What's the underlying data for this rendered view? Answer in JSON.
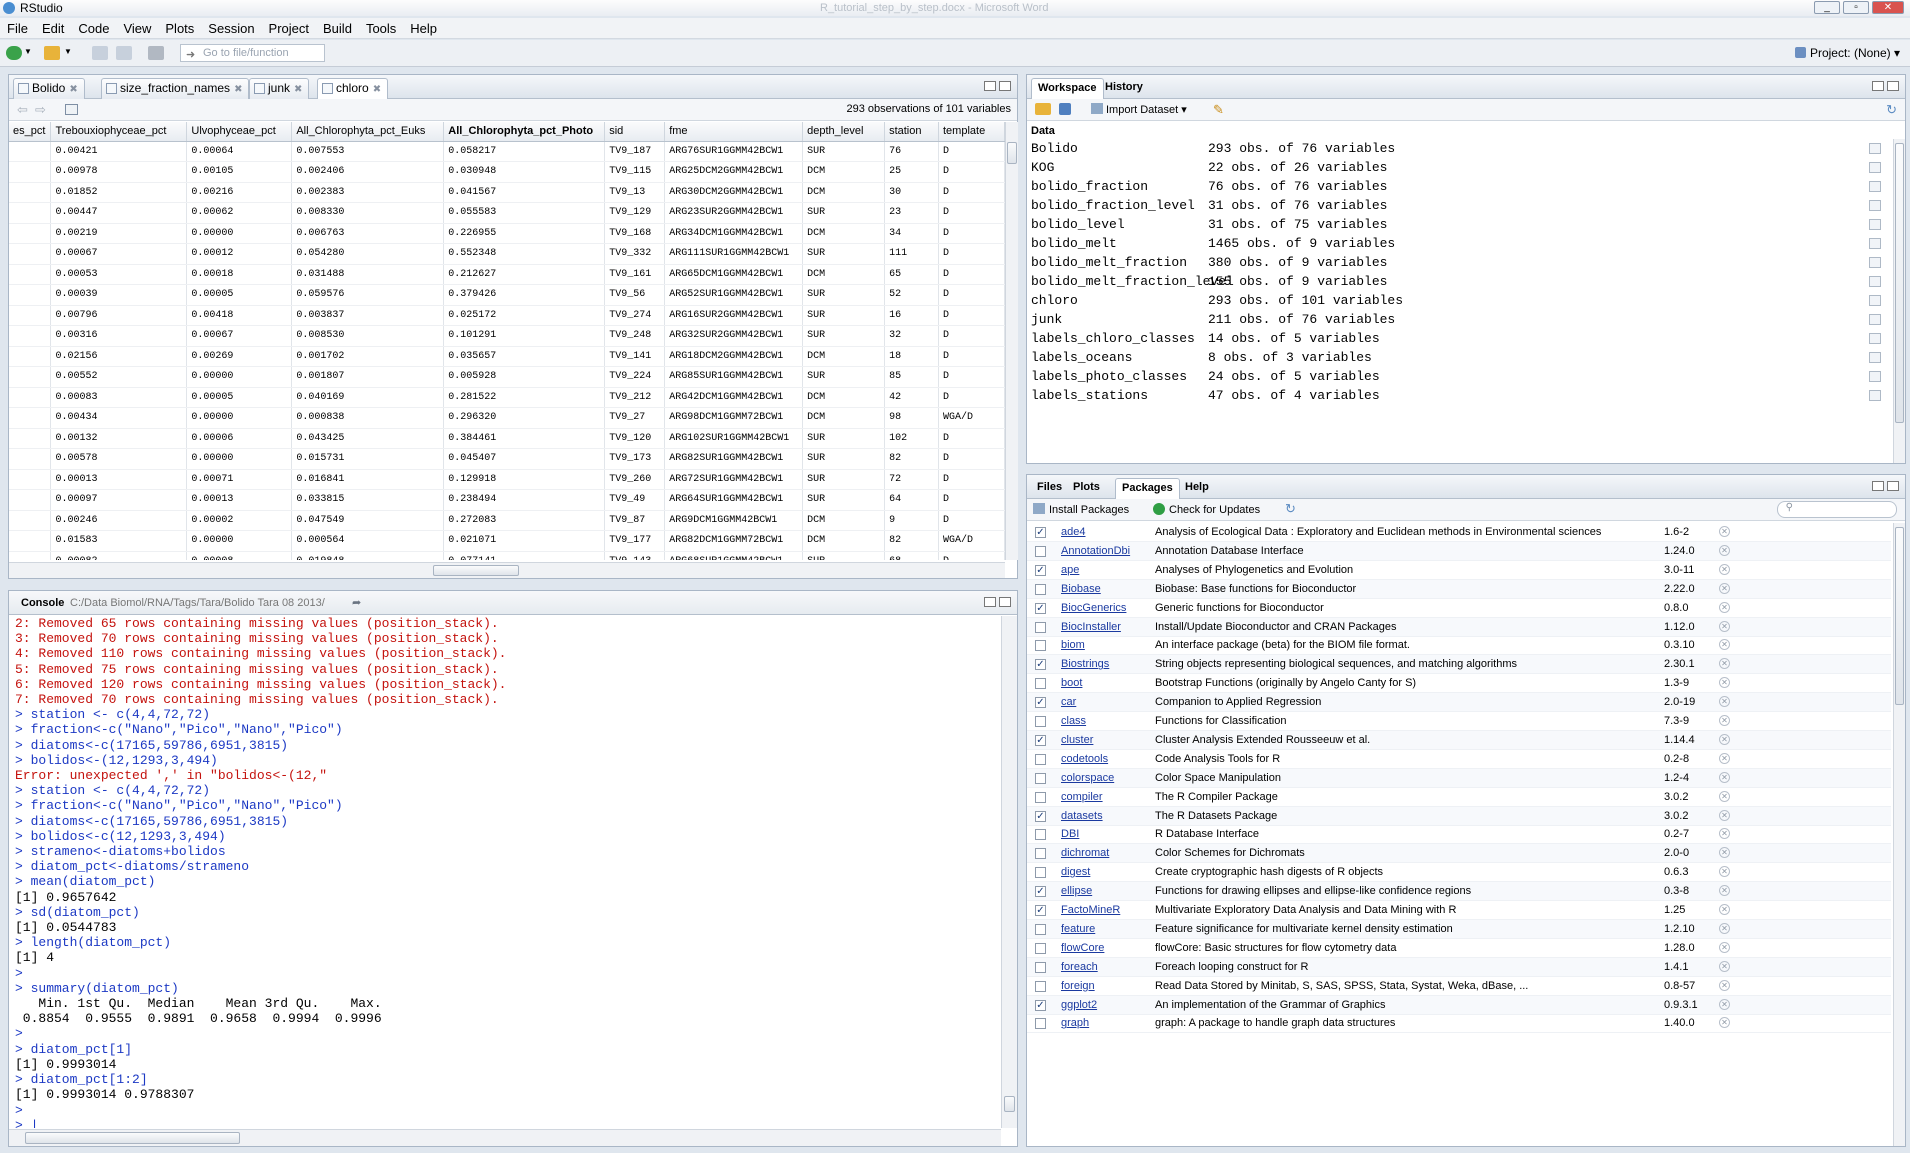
{
  "window": {
    "title": "RStudio",
    "background_title": "R_tutorial_step_by_step.docx - Microsoft Word"
  },
  "menu": [
    "File",
    "Edit",
    "Code",
    "View",
    "Plots",
    "Session",
    "Project",
    "Build",
    "Tools",
    "Help"
  ],
  "toolbar": {
    "goto_placeholder": "Go to file/function",
    "project_label": "Project: (None)"
  },
  "source": {
    "tabs": [
      "Bolido",
      "size_fraction_names",
      "junk",
      "chloro"
    ],
    "active_tab": "chloro",
    "summary": "293 observations of 101 variables",
    "columns": [
      "es_pct",
      "Trebouxiophyceae_pct",
      "Ulvophyceae_pct",
      "All_Chlorophyta_pct_Euks",
      "All_Chlorophyta_pct_Photo",
      "sid",
      "fme",
      "depth_level",
      "station",
      "template"
    ],
    "sorted_column": "All_Chlorophyta_pct_Photo",
    "rows": [
      [
        "",
        "0.00421",
        "0.00064",
        "0.007553",
        "0.058217",
        "TV9_187",
        "ARG76SUR1GGMM42BCW1",
        "SUR",
        "76",
        "D"
      ],
      [
        "",
        "0.00978",
        "0.00105",
        "0.002406",
        "0.030948",
        "TV9_115",
        "ARG25DCM2GGMM42BCW1",
        "DCM",
        "25",
        "D"
      ],
      [
        "",
        "0.01852",
        "0.00216",
        "0.002383",
        "0.041567",
        "TV9_13",
        "ARG30DCM2GGMM42BCW1",
        "DCM",
        "30",
        "D"
      ],
      [
        "",
        "0.00447",
        "0.00062",
        "0.008330",
        "0.055583",
        "TV9_129",
        "ARG23SUR2GGMM42BCW1",
        "SUR",
        "23",
        "D"
      ],
      [
        "",
        "0.00219",
        "0.00000",
        "0.006763",
        "0.226955",
        "TV9_168",
        "ARG34DCM1GGMM42BCW1",
        "DCM",
        "34",
        "D"
      ],
      [
        "",
        "0.00067",
        "0.00012",
        "0.054280",
        "0.552348",
        "TV9_332",
        "ARG111SUR1GGMM42BCW1",
        "SUR",
        "111",
        "D"
      ],
      [
        "",
        "0.00053",
        "0.00018",
        "0.031488",
        "0.212627",
        "TV9_161",
        "ARG65DCM1GGMM42BCW1",
        "DCM",
        "65",
        "D"
      ],
      [
        "",
        "0.00039",
        "0.00005",
        "0.059576",
        "0.379426",
        "TV9_56",
        "ARG52SUR1GGMM42BCW1",
        "SUR",
        "52",
        "D"
      ],
      [
        "",
        "0.00796",
        "0.00418",
        "0.003837",
        "0.025172",
        "TV9_274",
        "ARG16SUR2GGMM42BCW1",
        "SUR",
        "16",
        "D"
      ],
      [
        "",
        "0.00316",
        "0.00067",
        "0.008530",
        "0.101291",
        "TV9_248",
        "ARG32SUR2GGMM42BCW1",
        "SUR",
        "32",
        "D"
      ],
      [
        "",
        "0.02156",
        "0.00269",
        "0.001702",
        "0.035657",
        "TV9_141",
        "ARG18DCM2GGMM42BCW1",
        "DCM",
        "18",
        "D"
      ],
      [
        "",
        "0.00552",
        "0.00000",
        "0.001807",
        "0.005928",
        "TV9_224",
        "ARG85SUR1GGMM42BCW1",
        "SUR",
        "85",
        "D"
      ],
      [
        "",
        "0.00083",
        "0.00005",
        "0.040169",
        "0.281522",
        "TV9_212",
        "ARG42DCM1GGMM42BCW1",
        "DCM",
        "42",
        "D"
      ],
      [
        "",
        "0.00434",
        "0.00000",
        "0.000838",
        "0.296320",
        "TV9_27",
        "ARG98DCM1GGMM72BCW1",
        "DCM",
        "98",
        "WGA/D"
      ],
      [
        "",
        "0.00132",
        "0.00006",
        "0.043425",
        "0.384461",
        "TV9_120",
        "ARG102SUR1GGMM42BCW1",
        "SUR",
        "102",
        "D"
      ],
      [
        "",
        "0.00578",
        "0.00000",
        "0.015731",
        "0.045407",
        "TV9_173",
        "ARG82SUR1GGMM42BCW1",
        "SUR",
        "82",
        "D"
      ],
      [
        "",
        "0.00013",
        "0.00071",
        "0.016841",
        "0.129918",
        "TV9_260",
        "ARG72SUR1GGMM42BCW1",
        "SUR",
        "72",
        "D"
      ],
      [
        "",
        "0.00097",
        "0.00013",
        "0.033815",
        "0.238494",
        "TV9_49",
        "ARG64SUR1GGMM42BCW1",
        "SUR",
        "64",
        "D"
      ],
      [
        "",
        "0.00246",
        "0.00002",
        "0.047549",
        "0.272083",
        "TV9_87",
        "ARG9DCM1GGMM42BCW1",
        "DCM",
        "9",
        "D"
      ],
      [
        "",
        "0.01583",
        "0.00000",
        "0.000564",
        "0.021071",
        "TV9_177",
        "ARG82DCM1GGMM72BCW1",
        "DCM",
        "82",
        "WGA/D"
      ],
      [
        "",
        "0.00082",
        "0.00008",
        "0.019848",
        "0.077141",
        "TV9_143",
        "ARG68SUR1GGMM42BCW1",
        "SUR",
        "68",
        "D"
      ]
    ]
  },
  "console": {
    "title": "Console",
    "path": "C:/Data Biomol/RNA/Tags/Tara/Bolido Tara 08 2013/",
    "lines": [
      {
        "c": "red",
        "t": "2: Removed 65 rows containing missing values (position_stack)."
      },
      {
        "c": "red",
        "t": "3: Removed 70 rows containing missing values (position_stack)."
      },
      {
        "c": "red",
        "t": "4: Removed 110 rows containing missing values (position_stack)."
      },
      {
        "c": "red",
        "t": "5: Removed 75 rows containing missing values (position_stack)."
      },
      {
        "c": "red",
        "t": "6: Removed 120 rows containing missing values (position_stack)."
      },
      {
        "c": "red",
        "t": "7: Removed 70 rows containing missing values (position_stack)."
      },
      {
        "c": "blue",
        "t": "> station <- c(4,4,72,72)"
      },
      {
        "c": "blue",
        "t": "> fraction<-c(\"Nano\",\"Pico\",\"Nano\",\"Pico\")"
      },
      {
        "c": "blue",
        "t": "> diatoms<-c(17165,59786,6951,3815)"
      },
      {
        "c": "blue",
        "t": "> bolidos<-(12,1293,3,494)"
      },
      {
        "c": "red",
        "t": "Error: unexpected ',' in \"bolidos<-(12,\""
      },
      {
        "c": "blue",
        "t": "> station <- c(4,4,72,72)"
      },
      {
        "c": "blue",
        "t": "> fraction<-c(\"Nano\",\"Pico\",\"Nano\",\"Pico\")"
      },
      {
        "c": "blue",
        "t": "> diatoms<-c(17165,59786,6951,3815)"
      },
      {
        "c": "blue",
        "t": "> bolidos<-c(12,1293,3,494)"
      },
      {
        "c": "blue",
        "t": "> strameno<-diatoms+bolidos"
      },
      {
        "c": "blue",
        "t": "> diatom_pct<-diatoms/strameno"
      },
      {
        "c": "blue",
        "t": "> mean(diatom_pct)"
      },
      {
        "c": "black",
        "t": "[1] 0.9657642"
      },
      {
        "c": "blue",
        "t": "> sd(diatom_pct)"
      },
      {
        "c": "black",
        "t": "[1] 0.0544783"
      },
      {
        "c": "blue",
        "t": "> length(diatom_pct)"
      },
      {
        "c": "black",
        "t": "[1] 4"
      },
      {
        "c": "blue",
        "t": ">"
      },
      {
        "c": "blue",
        "t": "> summary(diatom_pct)"
      },
      {
        "c": "black",
        "t": "   Min. 1st Qu.  Median    Mean 3rd Qu.    Max. "
      },
      {
        "c": "black",
        "t": " 0.8854  0.9555  0.9891  0.9658  0.9994  0.9996 "
      },
      {
        "c": "blue",
        "t": ">"
      },
      {
        "c": "blue",
        "t": "> diatom_pct[1]"
      },
      {
        "c": "black",
        "t": "[1] 0.9993014"
      },
      {
        "c": "blue",
        "t": "> diatom_pct[1:2]"
      },
      {
        "c": "black",
        "t": "[1] 0.9993014 0.9788307"
      },
      {
        "c": "blue",
        "t": ">"
      },
      {
        "c": "blue",
        "t": "> |"
      }
    ]
  },
  "workspace": {
    "tabs": [
      "Workspace",
      "History"
    ],
    "import_label": "Import Dataset",
    "section": "Data",
    "items": [
      {
        "name": "Bolido",
        "desc": "293 obs. of 76 variables"
      },
      {
        "name": "KOG",
        "desc": "22 obs. of 26 variables"
      },
      {
        "name": "bolido_fraction",
        "desc": "76 obs. of 76 variables"
      },
      {
        "name": "bolido_fraction_level",
        "desc": "31 obs. of 76 variables"
      },
      {
        "name": "bolido_level",
        "desc": "31 obs. of 75 variables"
      },
      {
        "name": "bolido_melt",
        "desc": "1465 obs. of 9 variables"
      },
      {
        "name": "bolido_melt_fraction",
        "desc": "380 obs. of 9 variables"
      },
      {
        "name": "bolido_melt_fraction_level",
        "desc": "155 obs. of 9 variables"
      },
      {
        "name": "chloro",
        "desc": "293 obs. of 101 variables"
      },
      {
        "name": "junk",
        "desc": "211 obs. of 76 variables"
      },
      {
        "name": "labels_chloro_classes",
        "desc": "14 obs. of 5 variables"
      },
      {
        "name": "labels_oceans",
        "desc": "8 obs. of 3 variables"
      },
      {
        "name": "labels_photo_classes",
        "desc": "24 obs. of 5 variables"
      },
      {
        "name": "labels_stations",
        "desc": "47 obs. of 4 variables"
      }
    ]
  },
  "packages": {
    "tabs": [
      "Files",
      "Plots",
      "Packages",
      "Help"
    ],
    "install_label": "Install Packages",
    "update_label": "Check for Updates",
    "items": [
      {
        "n": "ade4",
        "d": "Analysis of Ecological Data : Exploratory and Euclidean methods in Environmental sciences",
        "v": "1.6-2",
        "c": true
      },
      {
        "n": "AnnotationDbi",
        "d": "Annotation Database Interface",
        "v": "1.24.0",
        "c": false
      },
      {
        "n": "ape",
        "d": "Analyses of Phylogenetics and Evolution",
        "v": "3.0-11",
        "c": true
      },
      {
        "n": "Biobase",
        "d": "Biobase: Base functions for Bioconductor",
        "v": "2.22.0",
        "c": false
      },
      {
        "n": "BiocGenerics",
        "d": "Generic functions for Bioconductor",
        "v": "0.8.0",
        "c": true
      },
      {
        "n": "BiocInstaller",
        "d": "Install/Update Bioconductor and CRAN Packages",
        "v": "1.12.0",
        "c": false
      },
      {
        "n": "biom",
        "d": "An interface package (beta) for the BIOM file format.",
        "v": "0.3.10",
        "c": false
      },
      {
        "n": "Biostrings",
        "d": "String objects representing biological sequences, and matching algorithms",
        "v": "2.30.1",
        "c": true
      },
      {
        "n": "boot",
        "d": "Bootstrap Functions (originally by Angelo Canty for S)",
        "v": "1.3-9",
        "c": false
      },
      {
        "n": "car",
        "d": "Companion to Applied Regression",
        "v": "2.0-19",
        "c": true
      },
      {
        "n": "class",
        "d": "Functions for Classification",
        "v": "7.3-9",
        "c": false
      },
      {
        "n": "cluster",
        "d": "Cluster Analysis Extended Rousseeuw et al.",
        "v": "1.14.4",
        "c": true
      },
      {
        "n": "codetools",
        "d": "Code Analysis Tools for R",
        "v": "0.2-8",
        "c": false
      },
      {
        "n": "colorspace",
        "d": "Color Space Manipulation",
        "v": "1.2-4",
        "c": false
      },
      {
        "n": "compiler",
        "d": "The R Compiler Package",
        "v": "3.0.2",
        "c": false
      },
      {
        "n": "datasets",
        "d": "The R Datasets Package",
        "v": "3.0.2",
        "c": true
      },
      {
        "n": "DBI",
        "d": "R Database Interface",
        "v": "0.2-7",
        "c": false
      },
      {
        "n": "dichromat",
        "d": "Color Schemes for Dichromats",
        "v": "2.0-0",
        "c": false
      },
      {
        "n": "digest",
        "d": "Create cryptographic hash digests of R objects",
        "v": "0.6.3",
        "c": false
      },
      {
        "n": "ellipse",
        "d": "Functions for drawing ellipses and ellipse-like confidence regions",
        "v": "0.3-8",
        "c": true
      },
      {
        "n": "FactoMineR",
        "d": "Multivariate Exploratory Data Analysis and Data Mining with R",
        "v": "1.25",
        "c": true
      },
      {
        "n": "feature",
        "d": "Feature significance for multivariate kernel density estimation",
        "v": "1.2.10",
        "c": false
      },
      {
        "n": "flowCore",
        "d": "flowCore: Basic structures for flow cytometry data",
        "v": "1.28.0",
        "c": false
      },
      {
        "n": "foreach",
        "d": "Foreach looping construct for R",
        "v": "1.4.1",
        "c": false
      },
      {
        "n": "foreign",
        "d": "Read Data Stored by Minitab, S, SAS, SPSS, Stata, Systat, Weka, dBase, ...",
        "v": "0.8-57",
        "c": false
      },
      {
        "n": "ggplot2",
        "d": "An implementation of the Grammar of Graphics",
        "v": "0.9.3.1",
        "c": true
      },
      {
        "n": "graph",
        "d": "graph: A package to handle graph data structures",
        "v": "1.40.0",
        "c": false
      }
    ]
  }
}
